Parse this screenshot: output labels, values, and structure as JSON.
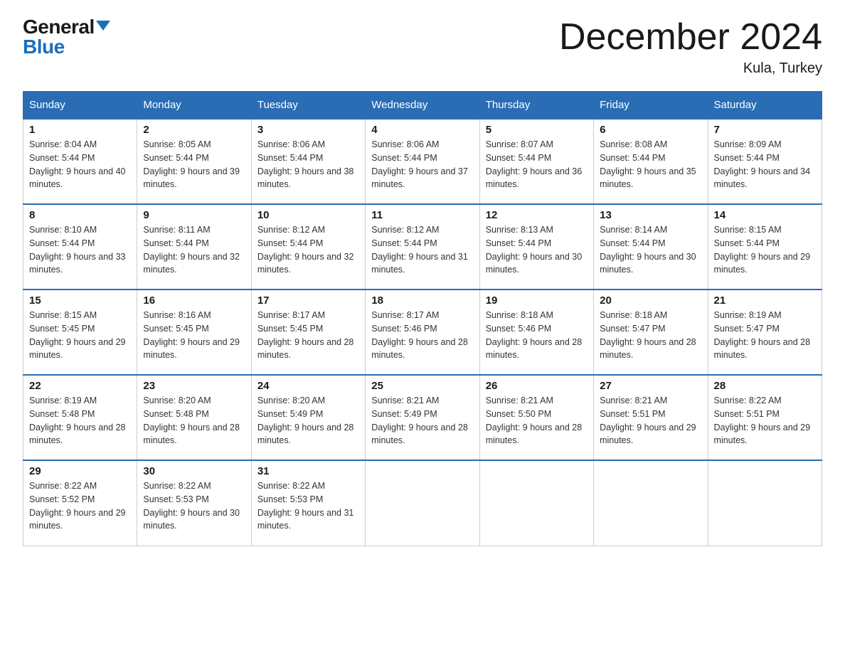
{
  "logo": {
    "general": "General",
    "blue": "Blue"
  },
  "title": "December 2024",
  "subtitle": "Kula, Turkey",
  "days_header": [
    "Sunday",
    "Monday",
    "Tuesday",
    "Wednesday",
    "Thursday",
    "Friday",
    "Saturday"
  ],
  "weeks": [
    [
      {
        "num": "1",
        "sunrise": "8:04 AM",
        "sunset": "5:44 PM",
        "daylight": "9 hours and 40 minutes."
      },
      {
        "num": "2",
        "sunrise": "8:05 AM",
        "sunset": "5:44 PM",
        "daylight": "9 hours and 39 minutes."
      },
      {
        "num": "3",
        "sunrise": "8:06 AM",
        "sunset": "5:44 PM",
        "daylight": "9 hours and 38 minutes."
      },
      {
        "num": "4",
        "sunrise": "8:06 AM",
        "sunset": "5:44 PM",
        "daylight": "9 hours and 37 minutes."
      },
      {
        "num": "5",
        "sunrise": "8:07 AM",
        "sunset": "5:44 PM",
        "daylight": "9 hours and 36 minutes."
      },
      {
        "num": "6",
        "sunrise": "8:08 AM",
        "sunset": "5:44 PM",
        "daylight": "9 hours and 35 minutes."
      },
      {
        "num": "7",
        "sunrise": "8:09 AM",
        "sunset": "5:44 PM",
        "daylight": "9 hours and 34 minutes."
      }
    ],
    [
      {
        "num": "8",
        "sunrise": "8:10 AM",
        "sunset": "5:44 PM",
        "daylight": "9 hours and 33 minutes."
      },
      {
        "num": "9",
        "sunrise": "8:11 AM",
        "sunset": "5:44 PM",
        "daylight": "9 hours and 32 minutes."
      },
      {
        "num": "10",
        "sunrise": "8:12 AM",
        "sunset": "5:44 PM",
        "daylight": "9 hours and 32 minutes."
      },
      {
        "num": "11",
        "sunrise": "8:12 AM",
        "sunset": "5:44 PM",
        "daylight": "9 hours and 31 minutes."
      },
      {
        "num": "12",
        "sunrise": "8:13 AM",
        "sunset": "5:44 PM",
        "daylight": "9 hours and 30 minutes."
      },
      {
        "num": "13",
        "sunrise": "8:14 AM",
        "sunset": "5:44 PM",
        "daylight": "9 hours and 30 minutes."
      },
      {
        "num": "14",
        "sunrise": "8:15 AM",
        "sunset": "5:44 PM",
        "daylight": "9 hours and 29 minutes."
      }
    ],
    [
      {
        "num": "15",
        "sunrise": "8:15 AM",
        "sunset": "5:45 PM",
        "daylight": "9 hours and 29 minutes."
      },
      {
        "num": "16",
        "sunrise": "8:16 AM",
        "sunset": "5:45 PM",
        "daylight": "9 hours and 29 minutes."
      },
      {
        "num": "17",
        "sunrise": "8:17 AM",
        "sunset": "5:45 PM",
        "daylight": "9 hours and 28 minutes."
      },
      {
        "num": "18",
        "sunrise": "8:17 AM",
        "sunset": "5:46 PM",
        "daylight": "9 hours and 28 minutes."
      },
      {
        "num": "19",
        "sunrise": "8:18 AM",
        "sunset": "5:46 PM",
        "daylight": "9 hours and 28 minutes."
      },
      {
        "num": "20",
        "sunrise": "8:18 AM",
        "sunset": "5:47 PM",
        "daylight": "9 hours and 28 minutes."
      },
      {
        "num": "21",
        "sunrise": "8:19 AM",
        "sunset": "5:47 PM",
        "daylight": "9 hours and 28 minutes."
      }
    ],
    [
      {
        "num": "22",
        "sunrise": "8:19 AM",
        "sunset": "5:48 PM",
        "daylight": "9 hours and 28 minutes."
      },
      {
        "num": "23",
        "sunrise": "8:20 AM",
        "sunset": "5:48 PM",
        "daylight": "9 hours and 28 minutes."
      },
      {
        "num": "24",
        "sunrise": "8:20 AM",
        "sunset": "5:49 PM",
        "daylight": "9 hours and 28 minutes."
      },
      {
        "num": "25",
        "sunrise": "8:21 AM",
        "sunset": "5:49 PM",
        "daylight": "9 hours and 28 minutes."
      },
      {
        "num": "26",
        "sunrise": "8:21 AM",
        "sunset": "5:50 PM",
        "daylight": "9 hours and 28 minutes."
      },
      {
        "num": "27",
        "sunrise": "8:21 AM",
        "sunset": "5:51 PM",
        "daylight": "9 hours and 29 minutes."
      },
      {
        "num": "28",
        "sunrise": "8:22 AM",
        "sunset": "5:51 PM",
        "daylight": "9 hours and 29 minutes."
      }
    ],
    [
      {
        "num": "29",
        "sunrise": "8:22 AM",
        "sunset": "5:52 PM",
        "daylight": "9 hours and 29 minutes."
      },
      {
        "num": "30",
        "sunrise": "8:22 AM",
        "sunset": "5:53 PM",
        "daylight": "9 hours and 30 minutes."
      },
      {
        "num": "31",
        "sunrise": "8:22 AM",
        "sunset": "5:53 PM",
        "daylight": "9 hours and 31 minutes."
      },
      null,
      null,
      null,
      null
    ]
  ]
}
